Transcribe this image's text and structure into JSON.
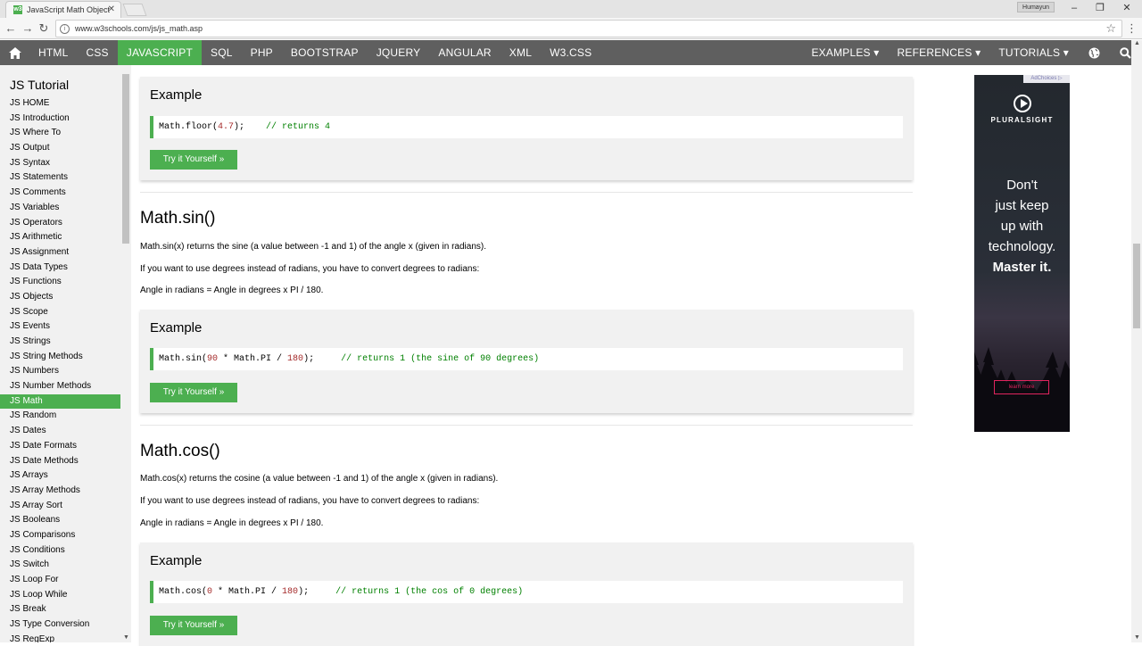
{
  "browser": {
    "tab_title": "JavaScript Math Object",
    "favicon": "w3",
    "user_name": "Humayun",
    "url": "www.w3schools.com/js/js_math.asp"
  },
  "nav": {
    "items": [
      "HTML",
      "CSS",
      "JAVASCRIPT",
      "SQL",
      "PHP",
      "BOOTSTRAP",
      "JQUERY",
      "ANGULAR",
      "XML",
      "W3.CSS"
    ],
    "right_items": [
      "EXAMPLES ▾",
      "REFERENCES ▾",
      "TUTORIALS ▾"
    ],
    "active": "JAVASCRIPT"
  },
  "sidebar": {
    "title": "JS Tutorial",
    "links": [
      "JS HOME",
      "JS Introduction",
      "JS Where To",
      "JS Output",
      "JS Syntax",
      "JS Statements",
      "JS Comments",
      "JS Variables",
      "JS Operators",
      "JS Arithmetic",
      "JS Assignment",
      "JS Data Types",
      "JS Functions",
      "JS Objects",
      "JS Scope",
      "JS Events",
      "JS Strings",
      "JS String Methods",
      "JS Numbers",
      "JS Number Methods",
      "JS Math",
      "JS Random",
      "JS Dates",
      "JS Date Formats",
      "JS Date Methods",
      "JS Arrays",
      "JS Array Methods",
      "JS Array Sort",
      "JS Booleans",
      "JS Comparisons",
      "JS Conditions",
      "JS Switch",
      "JS Loop For",
      "JS Loop While",
      "JS Break",
      "JS Type Conversion",
      "JS RegExp"
    ],
    "active_index": 20
  },
  "main": {
    "example_label": "Example",
    "try_label": "Try it Yourself »",
    "example1": {
      "code_a": "Math.floor(",
      "code_num": "4.7",
      "code_b": ");    ",
      "comment": "// returns 4"
    },
    "sin": {
      "heading": "Math.sin()",
      "p1": "Math.sin(x) returns the sine (a value between -1 and 1) of the angle x (given in radians).",
      "p2": "If you want to use degrees instead of radians, you have to convert degrees to radians:",
      "p3": "Angle in radians = Angle in degrees x PI / 180.",
      "code_a": "Math.sin(",
      "num1": "90",
      "code_b": " * Math.PI / ",
      "num2": "180",
      "code_c": ");     ",
      "comment": "// returns 1 (the sine of 90 degrees)"
    },
    "cos": {
      "heading": "Math.cos()",
      "p1": "Math.cos(x) returns the cosine (a value between -1 and 1) of the angle x (given in radians).",
      "p2": "If you want to use degrees instead of radians, you have to convert degrees to radians:",
      "p3": "Angle in radians = Angle in degrees x PI / 180.",
      "code_a": "Math.cos(",
      "num1": "0",
      "code_b": " * Math.PI / ",
      "num2": "180",
      "code_c": ");     ",
      "comment": "// returns 1 (the cos of 0 degrees)"
    }
  },
  "ad": {
    "choices": "AdChoices ▷",
    "brand": "PLURALSIGHT",
    "line1": "Don't",
    "line2": "just keep",
    "line3": "up with",
    "line4": "technology.",
    "line5": "Master it.",
    "cta": "learn more"
  },
  "colors": {
    "accent": "#4caf50",
    "nav": "#5f5f5f",
    "sidebar": "#f1f1f1",
    "number": "#a52a2a",
    "comment": "#008000"
  }
}
